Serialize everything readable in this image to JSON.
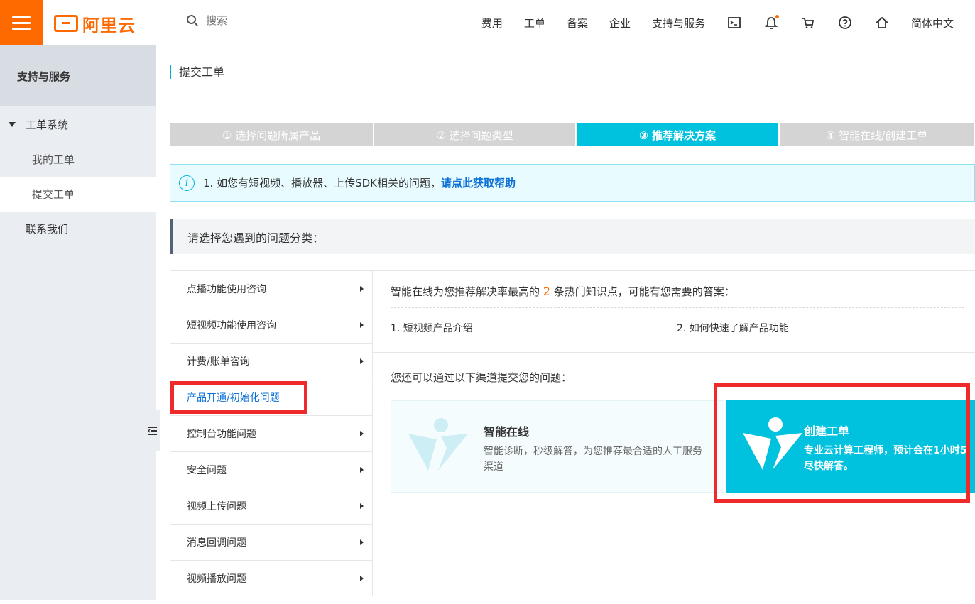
{
  "header": {
    "logo_text": "阿里云",
    "search_placeholder": "搜索",
    "nav": [
      "费用",
      "工单",
      "备案",
      "企业",
      "支持与服务"
    ],
    "language": "简体中文",
    "icons": [
      "terminal-icon",
      "bell-icon",
      "cart-icon",
      "help-icon",
      "home-icon"
    ],
    "accent_color": "#ff6a00"
  },
  "sidebar": {
    "title": "支持与服务",
    "group": "工单系统",
    "items": [
      "我的工单",
      "提交工单"
    ],
    "contact": "联系我们"
  },
  "page": {
    "title": "提交工单",
    "steps": [
      {
        "label": "① 选择问题所属产品"
      },
      {
        "label": "② 选择问题类型"
      },
      {
        "label": "③ 推荐解决方案"
      },
      {
        "label": "④ 智能在线/创建工单"
      }
    ],
    "active_step": 3,
    "notice": {
      "text": "1. 如您有短视频、播放器、上传SDK相关的问题，",
      "link": "请点此获取帮助"
    },
    "section_title": "请选择您遇到的问题分类："
  },
  "categories": [
    "点播功能使用咨询",
    "短视频功能使用咨询",
    "计费/账单咨询",
    "产品开通/初始化问题",
    "控制台功能问题",
    "安全问题",
    "视频上传问题",
    "消息回调问题",
    "视频播放问题"
  ],
  "active_category": "产品开通/初始化问题",
  "recommend": {
    "prefix": "智能在线为您推荐解决率最高的",
    "count": "2",
    "suffix": "条热门知识点，可能有您需要的答案：",
    "items": [
      "1. 短视频产品介绍",
      "2. 如何快速了解产品功能"
    ]
  },
  "channels": {
    "intro": "您还可以通过以下渠道提交您的问题：",
    "online": {
      "title": "智能在线",
      "desc": "智能诊断，秒级解答，为您推荐最合适的人工服务渠道"
    },
    "ticket": {
      "title": "创建工单",
      "desc_line1": "专业云计算工程师，预计会在1小时5",
      "desc_line2": "尽快解答。"
    }
  }
}
